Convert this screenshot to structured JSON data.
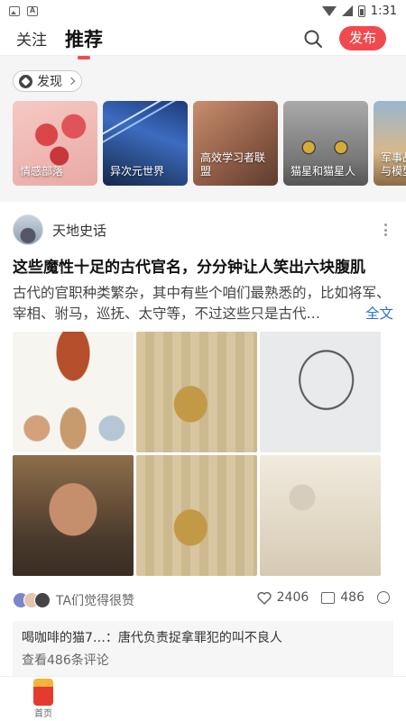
{
  "status_bar": {
    "time": "1:31",
    "icons": [
      "image-icon",
      "a-icon",
      "wifi-icon",
      "signal-icon",
      "battery-icon"
    ]
  },
  "top_nav": {
    "tabs": [
      {
        "label": "关注"
      },
      {
        "label": "推荐",
        "active": true
      }
    ],
    "search_icon": "search-icon",
    "publish_label": "发布",
    "accent_color": "#f04a4f"
  },
  "discover": {
    "chip_label": "发现",
    "cards": [
      {
        "label": "情感部落"
      },
      {
        "label": "异次元世界"
      },
      {
        "label": "高效学习者联盟"
      },
      {
        "label": "猫星和猫星人"
      },
      {
        "label": "军事战与模型"
      }
    ]
  },
  "post": {
    "author": "天地史话",
    "title": "这些魔性十足的古代官名，分分钟让人笑出六块腹肌",
    "summary": "古代的官职种类繁杂，其中有些个咱们最熟悉的，比如将军、宰相、驸马，巡抚、太守等，不过这些只是古代…",
    "full_text_label": "全文",
    "liked_text": "TA们觉得很赞",
    "like_count": "2406",
    "comment_count": "486",
    "comment_preview_author": "喝咖啡的猫7…",
    "comment_preview_text": "：唐代负责捉拿罪犯的叫不良人",
    "view_comments_label": "查看486条评论"
  },
  "bottom_nav": {
    "home_label": "首页"
  }
}
